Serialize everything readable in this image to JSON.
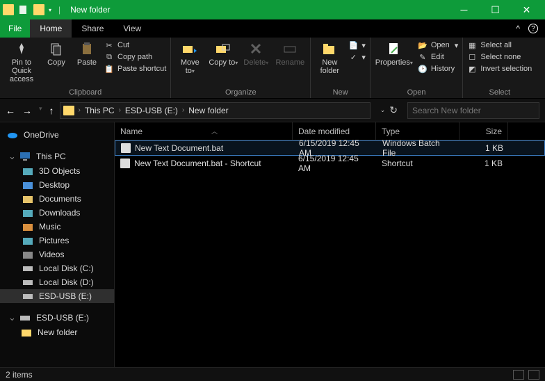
{
  "window": {
    "title": "New folder"
  },
  "tabs": {
    "file": "File",
    "home": "Home",
    "share": "Share",
    "view": "View"
  },
  "ribbon": {
    "pin": "Pin to Quick access",
    "copy": "Copy",
    "paste": "Paste",
    "cut": "Cut",
    "copy_path": "Copy path",
    "paste_shortcut": "Paste shortcut",
    "clipboard_group": "Clipboard",
    "move_to": "Move to",
    "copy_to": "Copy to",
    "delete": "Delete",
    "rename": "Rename",
    "organize_group": "Organize",
    "new_folder": "New folder",
    "new_group": "New",
    "properties": "Properties",
    "open": "Open",
    "edit": "Edit",
    "history": "History",
    "open_group": "Open",
    "select_all": "Select all",
    "select_none": "Select none",
    "invert_selection": "Invert selection",
    "select_group": "Select"
  },
  "breadcrumb": {
    "parts": [
      "This PC",
      "ESD-USB (E:)",
      "New folder"
    ]
  },
  "search": {
    "placeholder": "Search New folder"
  },
  "navpane": {
    "onedrive": "OneDrive",
    "this_pc": "This PC",
    "items": [
      "3D Objects",
      "Desktop",
      "Documents",
      "Downloads",
      "Music",
      "Pictures",
      "Videos",
      "Local Disk (C:)",
      "Local Disk (D:)",
      "ESD-USB (E:)"
    ],
    "second_root": "ESD-USB (E:)",
    "sub": "New folder"
  },
  "columns": {
    "name": "Name",
    "date": "Date modified",
    "type": "Type",
    "size": "Size"
  },
  "files": [
    {
      "name": "New Text Document.bat",
      "date": "6/15/2019 12:45 AM",
      "type": "Windows Batch File",
      "size": "1 KB",
      "selected": true
    },
    {
      "name": "New Text Document.bat - Shortcut",
      "date": "6/15/2019 12:45 AM",
      "type": "Shortcut",
      "size": "1 KB",
      "selected": false
    }
  ],
  "status": {
    "text": "2 items"
  }
}
